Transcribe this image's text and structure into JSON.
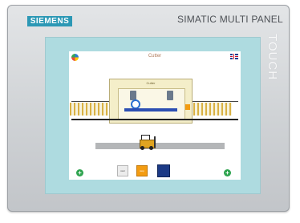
{
  "device": {
    "brand": "SIEMENS",
    "model": "SIMATIC MULTI PANEL",
    "touch": "TOUCH",
    "colors": {
      "brand_bar": "#2c98b5",
      "bezel": "#aedbe0",
      "workpiece": "#2c4fb3",
      "accent": "#f39c12"
    }
  },
  "screen": {
    "title": "Cutter",
    "machine_label": "Cutter",
    "start_label": "start",
    "stop_label": "stop",
    "icons": {
      "language": "globe-icon",
      "flag": "uk-flag-icon",
      "forklift": "forklift-icon",
      "add_left": "plus-circle-icon",
      "add_right": "plus-circle-icon"
    }
  }
}
